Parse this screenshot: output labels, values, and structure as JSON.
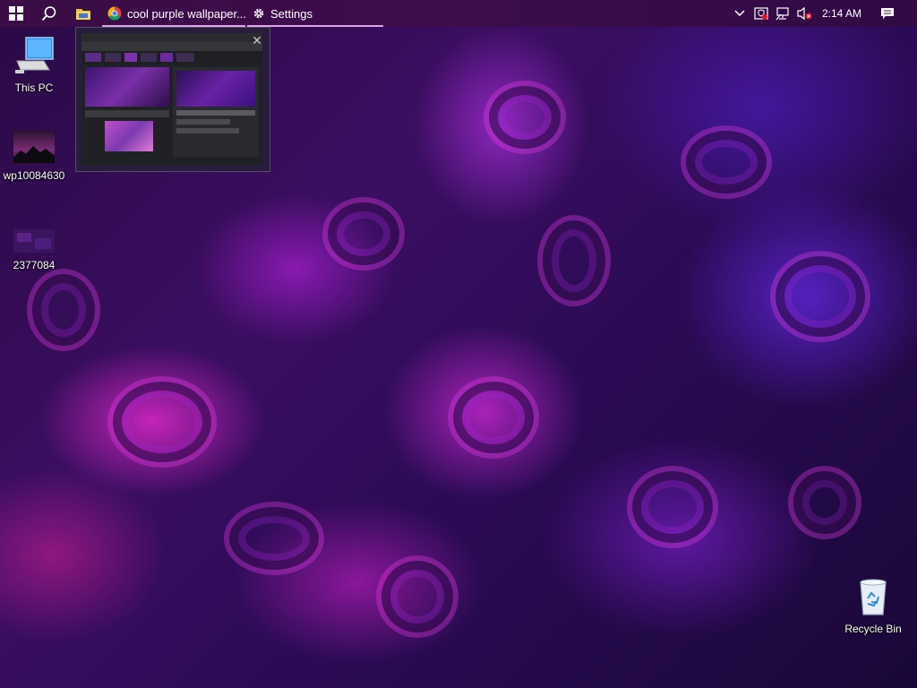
{
  "desktop": {
    "icons": [
      {
        "label": "This PC",
        "icon": "computer-icon"
      },
      {
        "label": "wp10084630",
        "icon": "image-file-icon"
      },
      {
        "label": "2377084",
        "icon": "image-file-icon"
      },
      {
        "label": "Recycle Bin",
        "icon": "recycle-bin-icon"
      }
    ]
  },
  "taskbar": {
    "start_icon": "windows-logo-icon",
    "search_icon": "search-icon",
    "explorer_icon": "folder-icon",
    "apps": [
      {
        "label": "cool purple wallpaper...",
        "icon": "chrome-icon"
      },
      {
        "label": "Settings",
        "icon": "gear-icon"
      }
    ],
    "tray": {
      "chevron_icon": "chevron-up-icon",
      "clock": "2:14 AM",
      "notification_icon": "action-center-icon"
    }
  },
  "colors": {
    "taskbar": "#3a0d46",
    "accent": "#d9a6e8"
  }
}
